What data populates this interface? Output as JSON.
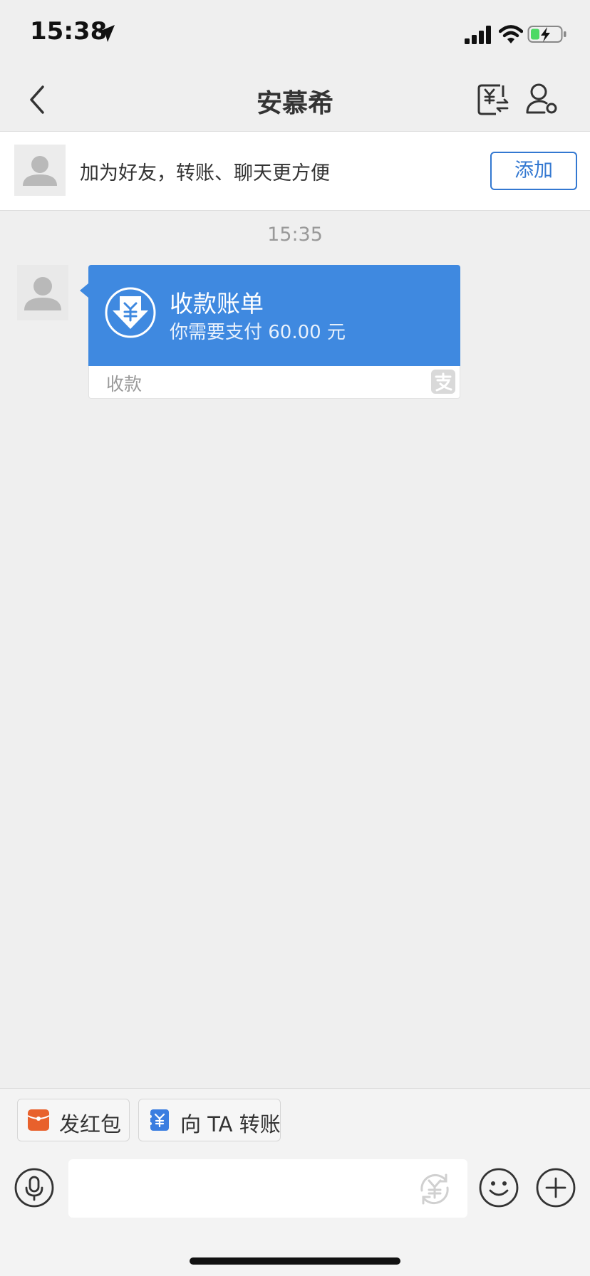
{
  "status_bar": {
    "time": "15:38"
  },
  "nav": {
    "title": "安慕希"
  },
  "friend_banner": {
    "text": "加为好友，转账、聊天更方便",
    "add_label": "添加"
  },
  "chat": {
    "timestamp": "15:35",
    "bill_message": {
      "title": "收款账单",
      "subtitle": "你需要支付 60.00 元",
      "footer": "收款"
    }
  },
  "quick_actions": {
    "red_packet": "发红包",
    "transfer": "向 TA 转账"
  },
  "colors": {
    "accent": "#3378d1",
    "bubble": "#3f89e0",
    "red_packet": "#e8612c",
    "transfer": "#3a7de0"
  },
  "icons": [
    "location-arrow-icon",
    "signal-icon",
    "wifi-icon",
    "battery-icon",
    "back-icon",
    "transfer-yuan-icon",
    "profile-settings-icon",
    "avatar-placeholder-icon",
    "yuan-download-icon",
    "alipay-icon",
    "red-packet-icon",
    "transfer-card-icon",
    "microphone-icon",
    "yuan-refresh-icon",
    "emoji-icon",
    "plus-icon"
  ]
}
